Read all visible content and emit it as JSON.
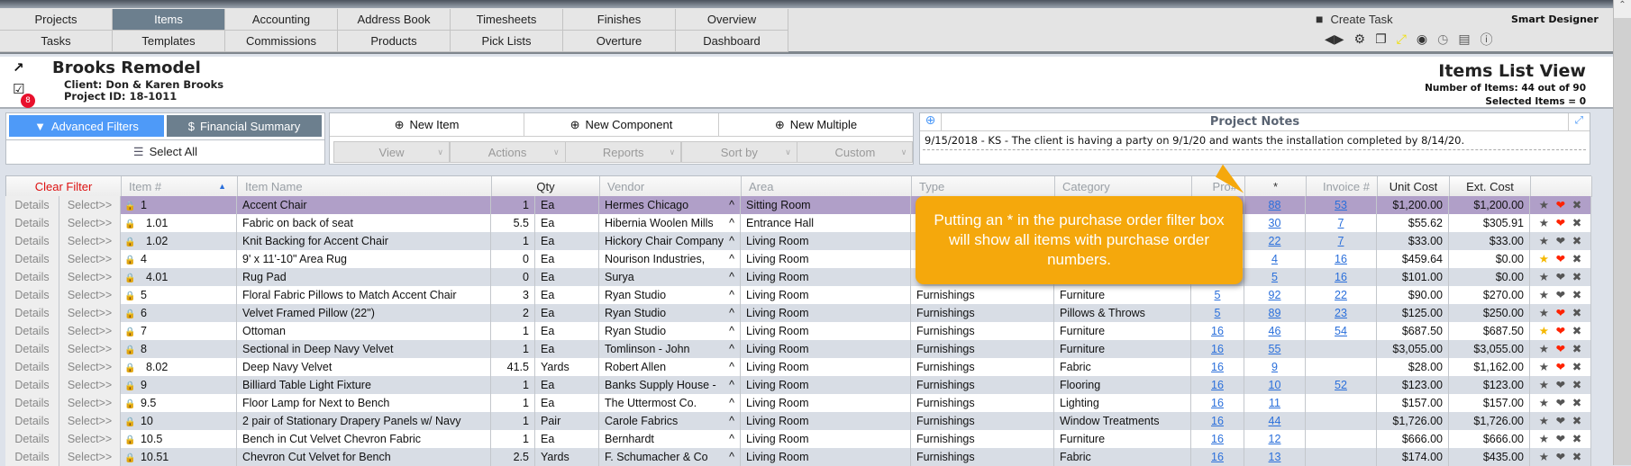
{
  "nav": {
    "row1": [
      "Projects",
      "Items",
      "Accounting",
      "Address Book",
      "Timesheets",
      "Finishes",
      "Overview"
    ],
    "row2": [
      "Tasks",
      "Templates",
      "Commissions",
      "Products",
      "Pick Lists",
      "Overture",
      "Dashboard"
    ],
    "active": "Items",
    "create_task": "Create Task",
    "app_name": "Smart Designer"
  },
  "header": {
    "title": "Brooks Remodel",
    "client": "Client: Don & Karen Brooks",
    "project_id": "Project ID: 18-1011",
    "task_badge": "8",
    "view_title": "Items List View",
    "item_count": "Number of Items: 44 out of 90",
    "selected": "Selected Items = 0"
  },
  "toolbar": {
    "advanced_filters": "Advanced Filters",
    "financial_summary": "Financial Summary",
    "select_all": "Select All",
    "new_item": "New Item",
    "new_component": "New Component",
    "new_multiple": "New Multiple",
    "dropdowns": [
      "View",
      "Actions",
      "Reports",
      "Sort by",
      "Custom"
    ]
  },
  "notes": {
    "title": "Project Notes",
    "text": "9/15/2018 - KS - The client is having a party on 9/1/20 and wants the installation completed by 8/14/20."
  },
  "table": {
    "clear_filter": "Clear Filter",
    "columns": [
      "Item #",
      "Item Name",
      "Qty",
      "Vendor",
      "Area",
      "Type",
      "Category",
      "Pro#",
      "*",
      "Invoice #",
      "Unit Cost",
      "Ext. Cost"
    ],
    "details_label": "Details",
    "select_label": "Select>>",
    "rows": [
      {
        "item": "1",
        "sub": false,
        "name": "Accent Chair",
        "qty": "1",
        "unit": "Ea",
        "vendor": "Hermes Chicago",
        "area": "Sitting Room",
        "type": "",
        "category": "",
        "pro": "",
        "po": "88",
        "invoice": "53",
        "unit_cost": "$1,200.00",
        "ext_cost": "$1,200.00",
        "star": false,
        "heart": true,
        "selected": true
      },
      {
        "item": "1.01",
        "sub": true,
        "name": "Fabric on back of seat",
        "qty": "5.5",
        "unit": "Ea",
        "vendor": "Hibernia Woolen Mills",
        "area": "Entrance Hall",
        "type": "",
        "category": "",
        "pro": "",
        "po": "30",
        "invoice": "7",
        "unit_cost": "$55.62",
        "ext_cost": "$305.91",
        "star": false,
        "heart": true
      },
      {
        "item": "1.02",
        "sub": true,
        "name": "Knit Backing for Accent Chair",
        "qty": "1",
        "unit": "Ea",
        "vendor": "Hickory Chair Company",
        "area": "Living Room",
        "type": "",
        "category": "",
        "pro": "",
        "po": "22",
        "invoice": "7",
        "unit_cost": "$33.00",
        "ext_cost": "$33.00",
        "star": false,
        "heart": false
      },
      {
        "item": "4",
        "sub": false,
        "name": "9' x 11'-10\" Area Rug",
        "qty": "0",
        "unit": "Ea",
        "vendor": "Nourison Industries,",
        "area": "Living Room",
        "type": "",
        "category": "",
        "pro": "",
        "po": "4",
        "invoice": "16",
        "unit_cost": "$459.64",
        "ext_cost": "$0.00",
        "star": true,
        "heart": true
      },
      {
        "item": "4.01",
        "sub": true,
        "name": "Rug Pad",
        "qty": "0",
        "unit": "Ea",
        "vendor": "Surya",
        "area": "Living Room",
        "type": "",
        "category": "",
        "pro": "",
        "po": "5",
        "invoice": "16",
        "unit_cost": "$101.00",
        "ext_cost": "$0.00",
        "star": false,
        "heart": false
      },
      {
        "item": "5",
        "sub": false,
        "name": "Floral Fabric Pillows to Match Accent Chair",
        "qty": "3",
        "unit": "Ea",
        "vendor": "Ryan Studio",
        "area": "Living Room",
        "type": "Furnishings",
        "category": "Furniture",
        "pro": "5",
        "po": "92",
        "invoice": "22",
        "unit_cost": "$90.00",
        "ext_cost": "$270.00",
        "star": false,
        "heart": false
      },
      {
        "item": "6",
        "sub": false,
        "name": "Velvet Framed Pillow (22\")",
        "qty": "2",
        "unit": "Ea",
        "vendor": "Ryan Studio",
        "area": "Living Room",
        "type": "Furnishings",
        "category": "Pillows & Throws",
        "pro": "5",
        "po": "89",
        "invoice": "23",
        "unit_cost": "$125.00",
        "ext_cost": "$250.00",
        "star": false,
        "heart": true
      },
      {
        "item": "7",
        "sub": false,
        "name": "Ottoman",
        "qty": "1",
        "unit": "Ea",
        "vendor": "Ryan Studio",
        "area": "Living Room",
        "type": "Furnishings",
        "category": "Furniture",
        "pro": "16",
        "po": "46",
        "invoice": "54",
        "unit_cost": "$687.50",
        "ext_cost": "$687.50",
        "star": true,
        "heart": true
      },
      {
        "item": "8",
        "sub": false,
        "name": "Sectional in Deep Navy Velvet",
        "qty": "1",
        "unit": "Ea",
        "vendor": "Tomlinson - John",
        "area": "Living Room",
        "type": "Furnishings",
        "category": "Furniture",
        "pro": "16",
        "po": "55",
        "invoice": "",
        "unit_cost": "$3,055.00",
        "ext_cost": "$3,055.00",
        "star": false,
        "heart": true
      },
      {
        "item": "8.02",
        "sub": true,
        "name": "Deep Navy Velvet",
        "qty": "41.5",
        "unit": "Yards",
        "vendor": "Robert Allen",
        "area": "Living Room",
        "type": "Furnishings",
        "category": "Fabric",
        "pro": "16",
        "po": "9",
        "invoice": "",
        "unit_cost": "$28.00",
        "ext_cost": "$1,162.00",
        "star": false,
        "heart": true
      },
      {
        "item": "9",
        "sub": false,
        "name": "Billiard Table Light Fixture",
        "qty": "1",
        "unit": "Ea",
        "vendor": "Banks Supply House -",
        "area": "Living Room",
        "type": "Furnishings",
        "category": "Flooring",
        "pro": "16",
        "po": "10",
        "invoice": "52",
        "unit_cost": "$123.00",
        "ext_cost": "$123.00",
        "star": false,
        "heart": false
      },
      {
        "item": "9.5",
        "sub": false,
        "name": "Floor Lamp for Next to Bench",
        "qty": "1",
        "unit": "Ea",
        "vendor": "The Uttermost Co.",
        "area": "Living Room",
        "type": "Furnishings",
        "category": "Lighting",
        "pro": "16",
        "po": "11",
        "invoice": "",
        "unit_cost": "$157.00",
        "ext_cost": "$157.00",
        "star": false,
        "heart": false
      },
      {
        "item": "10",
        "sub": false,
        "name": "2 pair of Stationary Drapery Panels w/ Navy",
        "qty": "1",
        "unit": "Pair",
        "vendor": "Carole Fabrics",
        "area": "Living Room",
        "type": "Furnishings",
        "category": "Window Treatments",
        "pro": "16",
        "po": "44",
        "invoice": "",
        "unit_cost": "$1,726.00",
        "ext_cost": "$1,726.00",
        "star": false,
        "heart": false
      },
      {
        "item": "10.5",
        "sub": false,
        "name": "Bench in Cut Velvet Chevron Fabric",
        "qty": "1",
        "unit": "Ea",
        "vendor": "Bernhardt",
        "area": "Living Room",
        "type": "Furnishings",
        "category": "Furniture",
        "pro": "16",
        "po": "12",
        "invoice": "",
        "unit_cost": "$666.00",
        "ext_cost": "$666.00",
        "star": false,
        "heart": false
      },
      {
        "item": "10.51",
        "sub": false,
        "name": "Chevron Cut Velvet for Bench",
        "qty": "2.5",
        "unit": "Yards",
        "vendor": "F. Schumacher & Co",
        "area": "Living Room",
        "type": "Furnishings",
        "category": "Fabric",
        "pro": "16",
        "po": "13",
        "invoice": "",
        "unit_cost": "$174.00",
        "ext_cost": "$435.00",
        "star": false,
        "heart": false
      }
    ]
  },
  "callout": {
    "text": "Putting an * in the purchase order filter box will show all items with purchase order numbers."
  },
  "colors": {
    "active_tab": "#6c7f8e",
    "advanced_filters": "#4e9af8",
    "financial_summary": "#6c7f8e",
    "selected_row": "#b09fc8",
    "alt_row": "#d8dde5",
    "callout": "#f5a80c",
    "link": "#2a6fdb",
    "heart_red": "#ff2200",
    "star_gold": "#f5b800",
    "clear_filter": "#d11"
  }
}
